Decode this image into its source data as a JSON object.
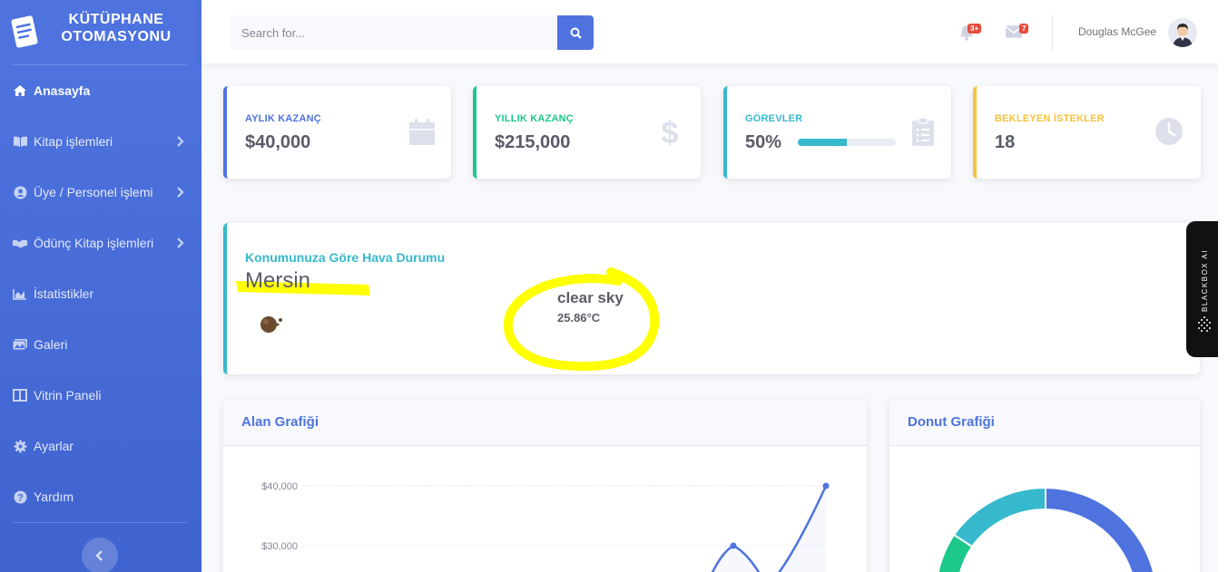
{
  "sidebar": {
    "brand": "KÜTÜPHANE OTOMASYONU",
    "items": [
      {
        "label": "Anasayfa",
        "icon": "home-icon"
      },
      {
        "label": "Kitap işlemleri",
        "icon": "book-icon"
      },
      {
        "label": "Üye / Personel işlemi",
        "icon": "user-circle-icon"
      },
      {
        "label": "Ödünç Kitap işlemleri",
        "icon": "handshake-icon"
      },
      {
        "label": "İstatistikler",
        "icon": "chart-area-icon"
      },
      {
        "label": "Galeri",
        "icon": "images-icon"
      },
      {
        "label": "Vitrin Paneli",
        "icon": "columns-icon"
      },
      {
        "label": "Ayarlar",
        "icon": "cog-icon"
      },
      {
        "label": "Yardım",
        "icon": "question-circle-icon"
      }
    ]
  },
  "topbar": {
    "search_placeholder": "Search for...",
    "alerts_badge": "3+",
    "messages_badge": "7",
    "user_name": "Douglas McGee"
  },
  "stats": [
    {
      "label": "AYLIK KAZANÇ",
      "value": "$40,000",
      "color": "#4e73df",
      "icon": "calendar-icon"
    },
    {
      "label": "YILLIK KAZANÇ",
      "value": "$215,000",
      "color": "#1cc88a",
      "icon": "dollar-icon"
    },
    {
      "label": "GÖREVLER",
      "value": "50%",
      "color": "#36b9cc",
      "icon": "clipboard-list-icon",
      "progress": 0.5
    },
    {
      "label": "BEKLEYEN İSTEKLER",
      "value": "18",
      "color": "#f6c23e",
      "icon": "clock-icon"
    }
  ],
  "weather": {
    "title": "Konumunuza Göre Hava Durumu",
    "city": "Mersin",
    "description": "clear sky",
    "temperature": "25.86°C"
  },
  "charts": {
    "area_title": "Alan Grafiği",
    "donut_title": "Donut Grafiği"
  },
  "chart_data": [
    {
      "type": "area",
      "title": "Alan Grafiği",
      "yticks": [
        "$40,000",
        "$30,000"
      ],
      "series": [
        {
          "values": [
            30000,
            26000,
            40000
          ]
        }
      ]
    },
    {
      "type": "pie",
      "title": "Donut Grafiği",
      "slices": [
        {
          "value": 55,
          "color": "#4e73df"
        },
        {
          "value": 30,
          "color": "#36b9cc"
        },
        {
          "value": 15,
          "color": "#1cc88a"
        }
      ]
    }
  ],
  "blackbox": {
    "label": "BLACKBOX AI"
  }
}
